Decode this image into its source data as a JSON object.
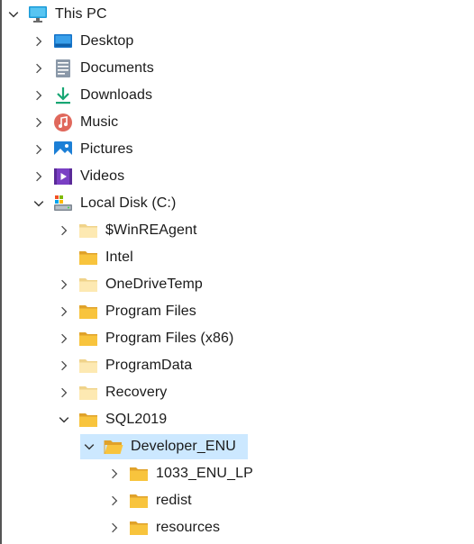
{
  "tree": {
    "this_pc": "This PC",
    "desktop": "Desktop",
    "documents": "Documents",
    "downloads": "Downloads",
    "music": "Music",
    "pictures": "Pictures",
    "videos": "Videos",
    "local_disk": "Local Disk (C:)",
    "winreagent": "$WinREAgent",
    "intel": "Intel",
    "onedrivetemp": "OneDriveTemp",
    "program_files": "Program Files",
    "program_files_x86": "Program Files (x86)",
    "programdata": "ProgramData",
    "recovery": "Recovery",
    "sql2019": "SQL2019",
    "developer_enu": "Developer_ENU",
    "lp_1033": "1033_ENU_LP",
    "redist": "redist",
    "resources": "resources"
  },
  "colors": {
    "selection": "#cce8ff",
    "folder": "#f8c43d",
    "folder_light": "#fde9b2",
    "chevron": "#4a4a4a"
  },
  "icons": {
    "this_pc": "monitor-icon",
    "desktop": "desktop-icon",
    "documents": "document-icon",
    "downloads": "download-arrow-icon",
    "music": "music-note-icon",
    "pictures": "picture-icon",
    "videos": "video-icon",
    "local_disk": "drive-icon",
    "folders": "folder-icon",
    "expand": "chevron-right-icon",
    "collapse": "chevron-down-icon"
  }
}
